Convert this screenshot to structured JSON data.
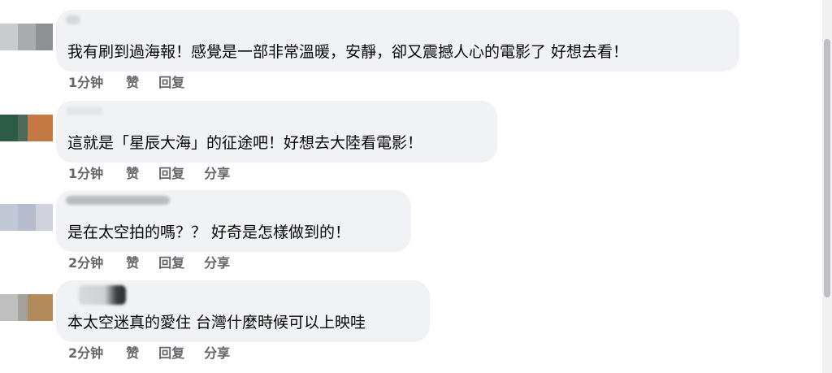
{
  "comments": [
    {
      "text": "我有刷到過海報！感覺是一部非常溫暖，安靜，卻又震撼人心的電影了 好想去看！",
      "time": "1分钟",
      "like": "赞",
      "reply": "回复",
      "share": "",
      "avatar_colors": [
        "#c9cbcf",
        "#a9abaf",
        "#8e9093"
      ]
    },
    {
      "text": "這就是「星辰大海」的征途吧！好想去大陸看電影！",
      "time": "1分钟",
      "like": "赞",
      "reply": "回复",
      "share": "分享",
      "avatar_colors": [
        "#2e5b45",
        "#4f6b58",
        "#c57a45"
      ]
    },
    {
      "text": "是在太空拍的嗎？？ 好奇是怎樣做到的！",
      "time": "2分钟",
      "like": "赞",
      "reply": "回复",
      "share": "分享",
      "avatar_colors": [
        "#c2c8d6",
        "#b4bccd",
        "#d0d3da"
      ]
    },
    {
      "text": "本太空迷真的愛住 台灣什麼時候可以上映哇",
      "time": "2分钟",
      "like": "赞",
      "reply": "回复",
      "share": "分享",
      "avatar_colors": [
        "#bfbfbf",
        "#a5a29c",
        "#b38a5c"
      ]
    }
  ],
  "colors": {
    "bubble": "#f0f2f5",
    "meta_text": "#65676b",
    "body_text": "#050505"
  }
}
